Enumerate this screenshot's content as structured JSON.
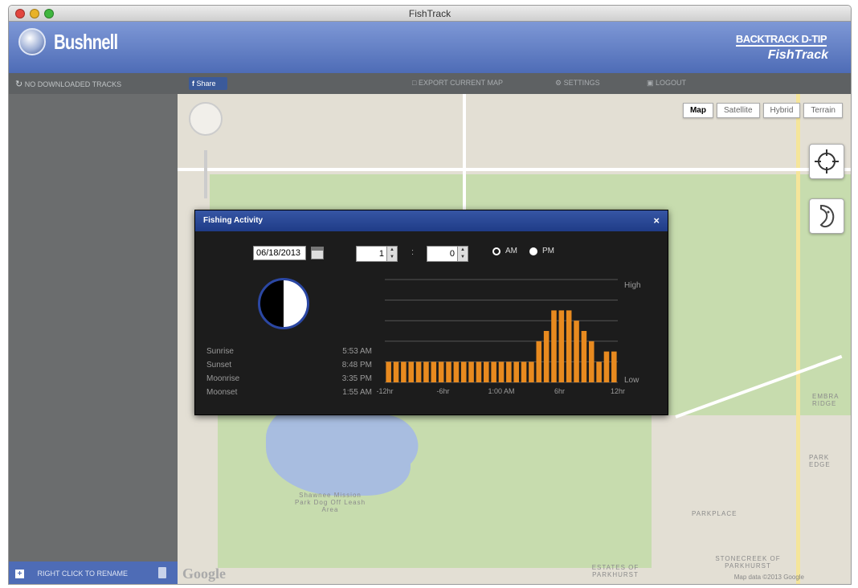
{
  "window": {
    "title": "FishTrack"
  },
  "header": {
    "brand": "Bushnell",
    "product_line1": "BACKTRACK D-TIP",
    "product_line2": "FishTrack"
  },
  "sidebar": {
    "header_text": "NO DOWNLOADED TRACKS",
    "footer_text": "RIGHT CLICK TO RENAME"
  },
  "toolbar": {
    "share": "Share",
    "export": "EXPORT CURRENT MAP",
    "settings": "SETTINGS",
    "logout": "LOGOUT"
  },
  "map": {
    "types": [
      "Map",
      "Satellite",
      "Hybrid",
      "Terrain"
    ],
    "active_type": "Map",
    "labels": {
      "park": "Shawnee Mission Park Dog Off Leash Area",
      "parkplace": "PARKPLACE",
      "estates": "ESTATES OF PARKHURST",
      "stonecreek": "STONECREEK OF PARKHURST",
      "park_edge": "PARK EDGE",
      "embra": "EMBRA RIDGE"
    },
    "google": "Google",
    "footer": "Map data ©2013 Google"
  },
  "dialog": {
    "title": "Fishing Activity",
    "close": "×",
    "date": "06/18/2013",
    "hour": "1",
    "minute": "0",
    "am_label": "AM",
    "pm_label": "PM",
    "selected_meridiem": "PM",
    "times": [
      {
        "name": "Sunrise",
        "value": "5:53 AM"
      },
      {
        "name": "Sunset",
        "value": "8:48 PM"
      },
      {
        "name": "Moonrise",
        "value": "3:35 PM"
      },
      {
        "name": "Moonset",
        "value": "1:55 AM"
      }
    ]
  },
  "chart_data": {
    "type": "bar",
    "title": "",
    "xlabel": "",
    "ylabel": "",
    "y_tick_labels": [
      "High",
      "Low"
    ],
    "x_tick_labels": [
      "-12hr",
      "-6hr",
      "1:00 AM",
      "6hr",
      "12hr"
    ],
    "ylim": [
      0,
      5
    ],
    "bar_color": "#e88a1f",
    "grid": true,
    "values": [
      1,
      1,
      1,
      1,
      1,
      1,
      1,
      1,
      1,
      1,
      1,
      1,
      1,
      1,
      1,
      1,
      1,
      1,
      1,
      1,
      2,
      2.5,
      3.5,
      3.5,
      3.5,
      3,
      2.5,
      2,
      1,
      1.5,
      1.5
    ]
  }
}
